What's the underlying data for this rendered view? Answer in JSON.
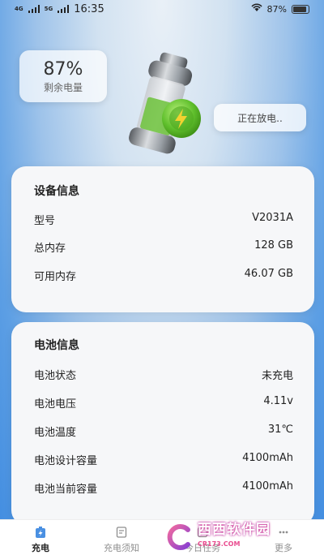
{
  "status": {
    "network_a": "4G",
    "network_b": "5G",
    "time": "16:35",
    "battery_pct": "87%"
  },
  "header": {
    "charge_percent": "87%",
    "charge_label": "剩余电量",
    "status_bubble": "正在放电.."
  },
  "device_info": {
    "title": "设备信息",
    "rows": [
      {
        "label": "型号",
        "value": "V2031A"
      },
      {
        "label": "总内存",
        "value": "128 GB"
      },
      {
        "label": "可用内存",
        "value": "46.07 GB"
      }
    ]
  },
  "battery_info": {
    "title": "电池信息",
    "rows": [
      {
        "label": "电池状态",
        "value": "未充电"
      },
      {
        "label": "电池电压",
        "value": "4.11v"
      },
      {
        "label": "电池温度",
        "value": "31℃"
      },
      {
        "label": "电池设计容量",
        "value": "4100mAh"
      },
      {
        "label": "电池当前容量",
        "value": "4100mAh"
      }
    ]
  },
  "tabs": [
    {
      "label": "充电",
      "icon": "battery-icon",
      "active": true
    },
    {
      "label": "充电须知",
      "icon": "document-icon",
      "active": false
    },
    {
      "label": "今日任务",
      "icon": "task-icon",
      "active": false
    },
    {
      "label": "更多",
      "icon": "more-icon",
      "active": false
    }
  ],
  "watermark": {
    "main": "西西软件园",
    "sub": "CR173.COM"
  },
  "colors": {
    "accent_green": "#6cc23a",
    "tab_active_blue": "#4a90e2"
  }
}
